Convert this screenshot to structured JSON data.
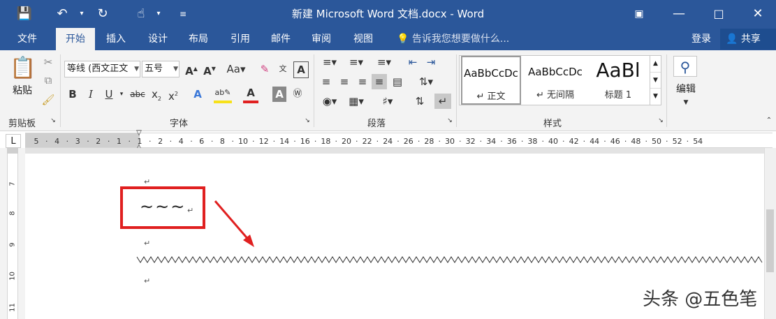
{
  "window": {
    "title": "新建 Microsoft Word 文档.docx - Word"
  },
  "ribbon_tabs": [
    "文件",
    "开始",
    "插入",
    "设计",
    "布局",
    "引用",
    "邮件",
    "审阅",
    "视图"
  ],
  "tell_me": "告诉我您想要做什么...",
  "account": {
    "login": "登录",
    "share": "共享"
  },
  "clipboard": {
    "paste_label": "粘贴",
    "group_label": "剪贴板"
  },
  "font": {
    "font_name": "等线 (西文正文",
    "font_size": "五号",
    "group_label": "字体"
  },
  "paragraph": {
    "group_label": "段落"
  },
  "styles": {
    "group_label": "样式",
    "items": [
      {
        "preview": "AaBbCcDc",
        "name": "↵ 正文"
      },
      {
        "preview": "AaBbCcDc",
        "name": "↵ 无间隔"
      },
      {
        "preview": "AaBl",
        "name": "标题 1"
      }
    ]
  },
  "editing": {
    "label": "编辑"
  },
  "ruler": {
    "corner_label": "L",
    "ticks": [
      "5",
      "4",
      "3",
      "2",
      "1",
      "1",
      "2",
      "4",
      "6",
      "8",
      "10",
      "12",
      "14",
      "16",
      "18",
      "20",
      "22",
      "24",
      "26",
      "28",
      "30",
      "32",
      "34",
      "36",
      "38",
      "40",
      "42",
      "44",
      "46",
      "48",
      "50",
      "52",
      "54"
    ]
  },
  "document": {
    "tilde_text": "~~~",
    "para_mark": "↵"
  },
  "watermark": "头条 @五色笔"
}
